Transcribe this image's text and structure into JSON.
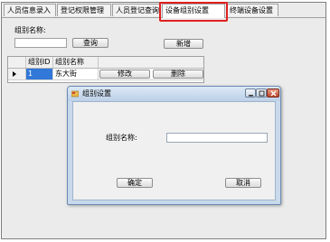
{
  "tabs": [
    {
      "label": "人员信息录入",
      "active": false
    },
    {
      "label": "登记权限管理",
      "active": false
    },
    {
      "label": "人员登记查询",
      "active": false
    },
    {
      "label": "设备组别设置",
      "active": true
    },
    {
      "label": "终端设备设置",
      "active": false
    }
  ],
  "search": {
    "label": "组别名称:",
    "value": "",
    "query_button": "查询",
    "new_button": "新增"
  },
  "grid": {
    "columns": [
      "组别ID",
      "组别名称"
    ],
    "rows": [
      {
        "id": "1",
        "name": "东大街",
        "edit_button": "修改",
        "delete_button": "删除"
      }
    ]
  },
  "dialog": {
    "title": "组别设置",
    "field_label": "组别名称:",
    "field_value": "",
    "ok_button": "确定",
    "cancel_button": "取消"
  },
  "colors": {
    "highlight": "#e02020",
    "selection": "#3178d8",
    "dialog_frame": "#c9d9ec"
  }
}
